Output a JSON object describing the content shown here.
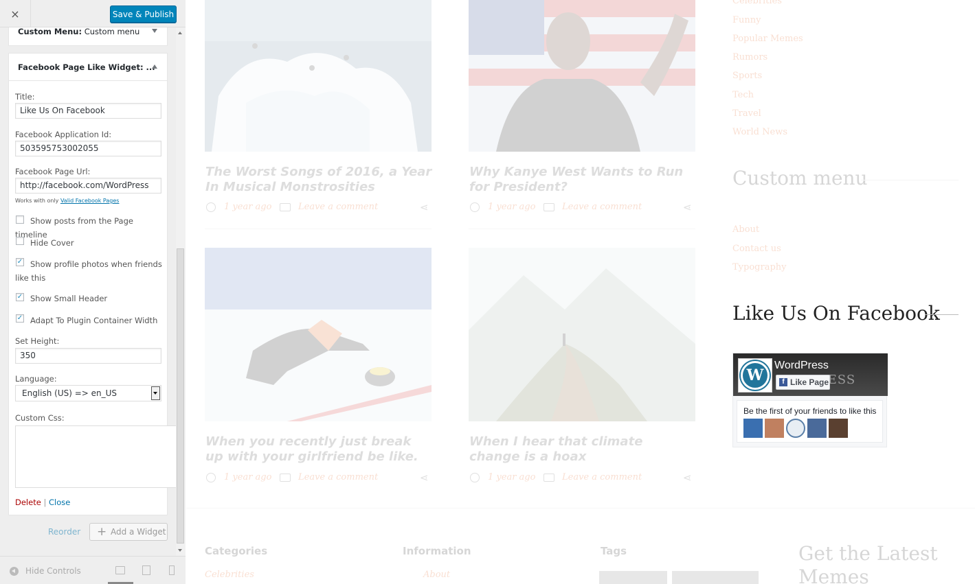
{
  "header": {
    "close_icon": "×",
    "save_label": "Save & Publish"
  },
  "collapsed_widget": {
    "label_bold": "Custom Menu:",
    "label_rest": " Custom menu"
  },
  "widget": {
    "title": "Facebook Page Like Widget: ...",
    "fields": {
      "title_label": "Title:",
      "title_value": "Like Us On Facebook",
      "appid_label": "Facebook Application Id:",
      "appid_value": "503595753002055",
      "url_label": "Facebook Page Url:",
      "url_value": "http://facebook.com/WordPress",
      "note_prefix": "Works with only ",
      "note_link": "Valid Facebook Pages",
      "height_label": "Set Height:",
      "height_value": "350",
      "language_label": "Language:",
      "language_value": "English (US) => en_US",
      "css_label": "Custom Css:"
    },
    "checkboxes": [
      {
        "label": "Show posts from the Page timeline",
        "checked": false
      },
      {
        "label": "Hide Cover",
        "checked": false
      },
      {
        "label": "Show profile photos when friends like this",
        "checked": true
      },
      {
        "label": "Show Small Header",
        "checked": true
      },
      {
        "label": "Adapt To Plugin Container Width",
        "checked": true
      }
    ],
    "delete_label": "Delete",
    "sep": "|",
    "close_label": "Close"
  },
  "actions": {
    "reorder_label": "Reorder",
    "add_widget_label": "Add a Widget"
  },
  "footer": {
    "hide_controls_label": "Hide Controls"
  },
  "posts": [
    {
      "title": "The Worst Songs of 2016, a Year In Musical Monstrosities",
      "time": "1 year ago",
      "comment": "Leave a comment"
    },
    {
      "title": "Why Kanye West Wants to Run for President?",
      "time": "1 year ago",
      "comment": "Leave a comment"
    },
    {
      "title": "When you recently just break up with your girlfriend be like.",
      "time": "1 year ago",
      "comment": "Leave a comment"
    },
    {
      "title": "When I hear that climate change is a hoax",
      "time": "1 year ago",
      "comment": "Leave a comment"
    }
  ],
  "sidebar": {
    "categories": [
      "Celebrities",
      "Funny",
      "Popular Memes",
      "Rumors",
      "Sports",
      "Tech",
      "Travel",
      "World News"
    ],
    "custom_menu_title": "Custom menu",
    "custom_menu_links": [
      "About",
      "Contact us",
      "Typography"
    ],
    "facebook_title": "Like Us On Facebook",
    "fb_page_name": "WordPress",
    "fb_like_label": "Like Page",
    "fb_friends_text": "Be the first of your friends to like this"
  },
  "footer_area": {
    "categories_title": "Categories",
    "first_category": "Celebrities",
    "information_title": "Information",
    "info_first": "About",
    "tags_title": "Tags",
    "newsletter_title": "Get the Latest Memes Delivered"
  },
  "colors": {
    "accent": "#0085ba",
    "link": "#e06020",
    "facebook": "#3b5998"
  }
}
